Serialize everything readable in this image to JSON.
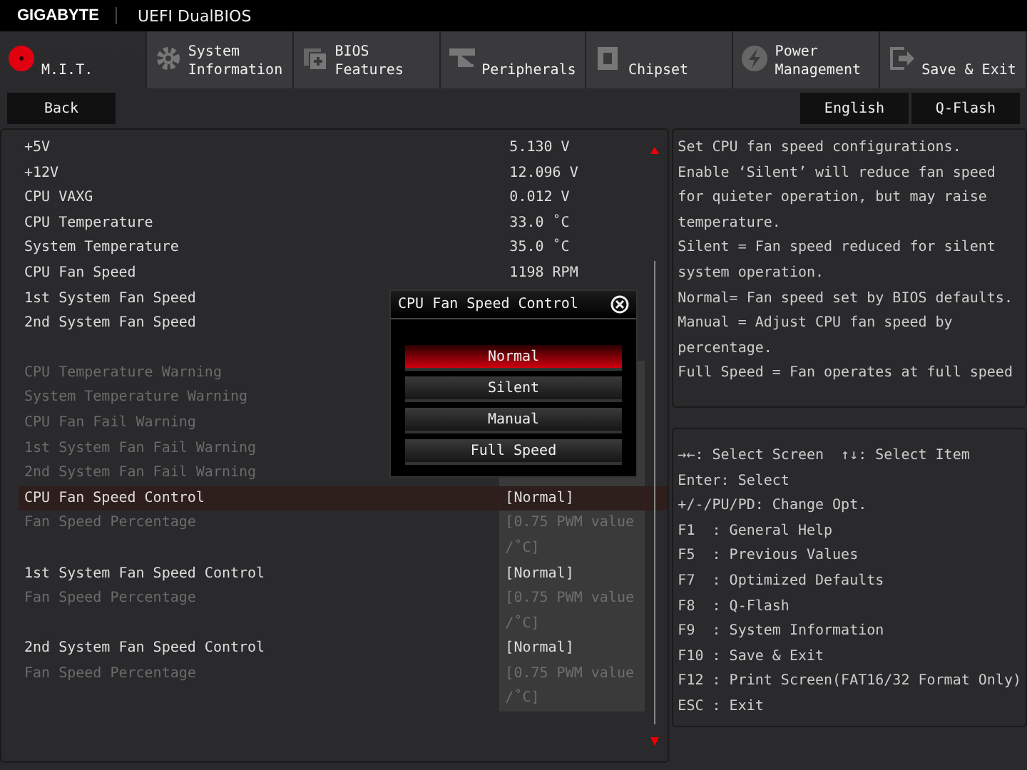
{
  "header": {
    "brand": "GIGABYTE",
    "title": "UEFI DualBIOS"
  },
  "tabs": [
    {
      "label": "M.I.T.",
      "selected": true
    },
    {
      "label": "System Information",
      "selected": false
    },
    {
      "label": "BIOS Features",
      "selected": false
    },
    {
      "label": "Peripherals",
      "selected": false
    },
    {
      "label": "Chipset",
      "selected": false
    },
    {
      "label": "Power Management",
      "selected": false
    },
    {
      "label": "Save & Exit",
      "selected": false
    }
  ],
  "toolbar": {
    "back": "Back",
    "language": "English",
    "qflash": "Q-Flash"
  },
  "groups": [
    [
      {
        "kind": "reading",
        "label": "+5V",
        "value": "5.130 V"
      },
      {
        "kind": "reading",
        "label": "+12V",
        "value": "12.096 V"
      },
      {
        "kind": "reading",
        "label": "CPU VAXG",
        "value": "0.012 V"
      },
      {
        "kind": "reading",
        "label": "CPU Temperature",
        "value": "33.0 ˚C"
      },
      {
        "kind": "reading",
        "label": "System Temperature",
        "value": "35.0 ˚C"
      },
      {
        "kind": "reading",
        "label": "CPU Fan Speed",
        "value": "1198 RPM"
      },
      {
        "kind": "reading",
        "label": "1st System Fan Speed"
      },
      {
        "kind": "reading",
        "label": "2nd System Fan Speed"
      }
    ],
    [
      {
        "kind": "setting",
        "label": "CPU Temperature Warning",
        "disabled": true,
        "selected": false
      },
      {
        "kind": "setting",
        "label": "System Temperature Warning",
        "disabled": true,
        "selected": false
      },
      {
        "kind": "setting",
        "label": "CPU Fan Fail Warning",
        "disabled": true,
        "selected": false
      },
      {
        "kind": "setting",
        "label": "1st System Fan Fail Warning",
        "disabled": true,
        "selected": false
      },
      {
        "kind": "setting",
        "label": "2nd System Fan Fail Warning",
        "disabled": true,
        "selected": false
      },
      {
        "kind": "setting",
        "label": "CPU Fan Speed Control",
        "value": "[Normal]",
        "disabled": false,
        "selected": true
      },
      {
        "kind": "setting",
        "label": "Fan Speed Percentage",
        "value": "[0.75 PWM value /˚C]",
        "disabled": true,
        "selected": false
      },
      {
        "kind": "setting",
        "label": "1st System Fan Speed Control",
        "value": "[Normal]",
        "disabled": false,
        "selected": false
      },
      {
        "kind": "setting",
        "label": "Fan Speed Percentage",
        "value": "[0.75 PWM value /˚C]",
        "disabled": true,
        "selected": false
      },
      {
        "kind": "setting",
        "label": "2nd System Fan Speed Control",
        "value": "[Normal]",
        "disabled": false,
        "selected": false
      },
      {
        "kind": "setting",
        "label": "Fan Speed Percentage",
        "value": "[0.75 PWM value /˚C]",
        "disabled": true,
        "selected": false
      }
    ]
  ],
  "popup": {
    "title": "CPU Fan Speed Control",
    "options": [
      {
        "label": "Normal",
        "selected": true
      },
      {
        "label": "Silent",
        "selected": false
      },
      {
        "label": "Manual",
        "selected": false
      },
      {
        "label": "Full Speed",
        "selected": false
      }
    ]
  },
  "help": [
    "Set CPU fan speed configurations.",
    "Enable ‘Silent’ will reduce fan speed for quieter operation, but may raise temperature.",
    "Silent = Fan speed reduced for silent system operation.",
    "Normal= Fan speed set by BIOS defaults.",
    "Manual = Adjust CPU fan speed by percentage.",
    "Full Speed = Fan operates at full speed"
  ],
  "keys": [
    "→←: Select Screen  ↑↓: Select Item",
    "Enter: Select",
    "+/-/PU/PD: Change Opt.",
    "F1  : General Help",
    "F5  : Previous Values",
    "F7  : Optimized Defaults",
    "F8  : Q-Flash",
    "F9  : System Information",
    "F10 : Save & Exit",
    "F12 : Print Screen(FAT16/32 Format Only)",
    "ESC : Exit"
  ]
}
